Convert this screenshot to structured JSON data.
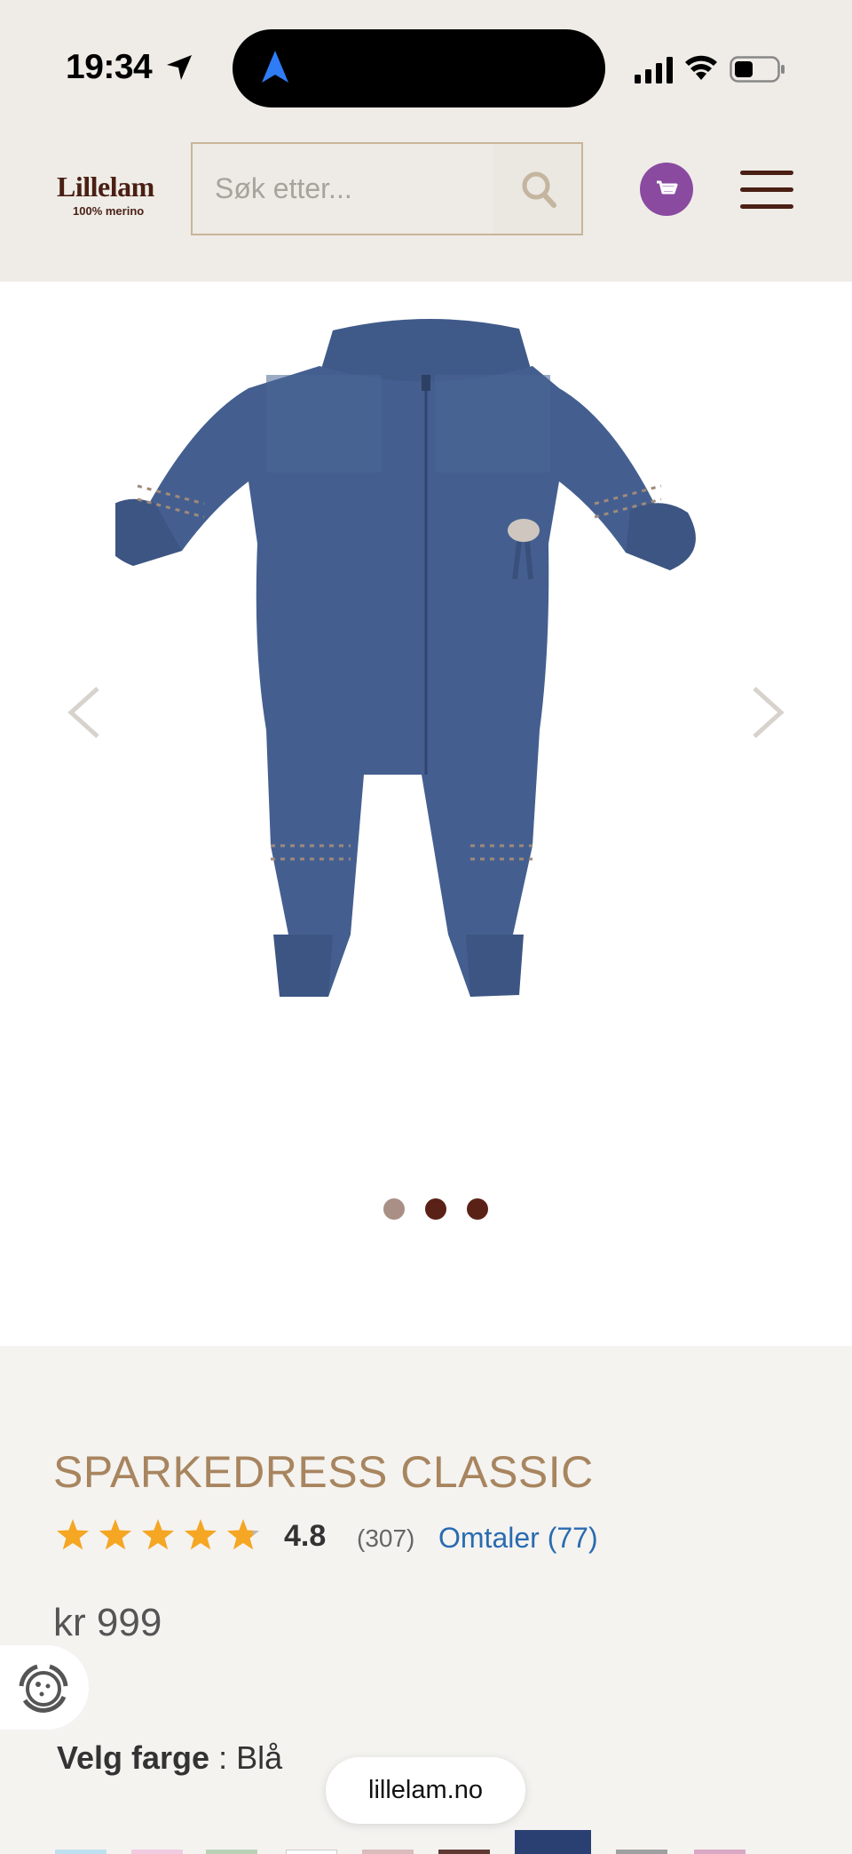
{
  "status_bar": {
    "time": "19:34"
  },
  "header": {
    "logo": {
      "name": "Lillelam",
      "subtitle": "100% merino"
    },
    "search": {
      "placeholder": "Søk etter..."
    },
    "icons": {
      "search": "search-icon",
      "cart": "cart-icon",
      "menu": "hamburger-menu-icon"
    }
  },
  "gallery": {
    "image_alt": "sparkedress-blue-knit",
    "slide_count": 3,
    "active_slide": 1,
    "dot_colors": [
      "#a98f85",
      "#5a2216",
      "#5a2216"
    ]
  },
  "product": {
    "title": "SPARKEDRESS CLASSIC",
    "rating": "4.8",
    "rating_fraction": 0.96,
    "rating_count": "(307)",
    "reviews_link": "Omtaler (77)",
    "price": "kr 999",
    "color_label": "Velg farge",
    "color_value": " : Blå"
  },
  "swatch_colors": [
    "#bfe0f0",
    "#f1cce0",
    "#b9d2b6",
    "#ffffff",
    "#d9bcbb",
    "#5e3a33",
    "#2a3f72",
    "#9ea0a1",
    "#d8a8c4"
  ],
  "browser": {
    "url": "lillelam.no"
  },
  "colors": {
    "accent_title": "#a8855f",
    "brand_brown": "#4a1f14",
    "cart_purple": "#8a4aa0",
    "link_blue": "#2a6bb0",
    "star": "#f5a623"
  }
}
